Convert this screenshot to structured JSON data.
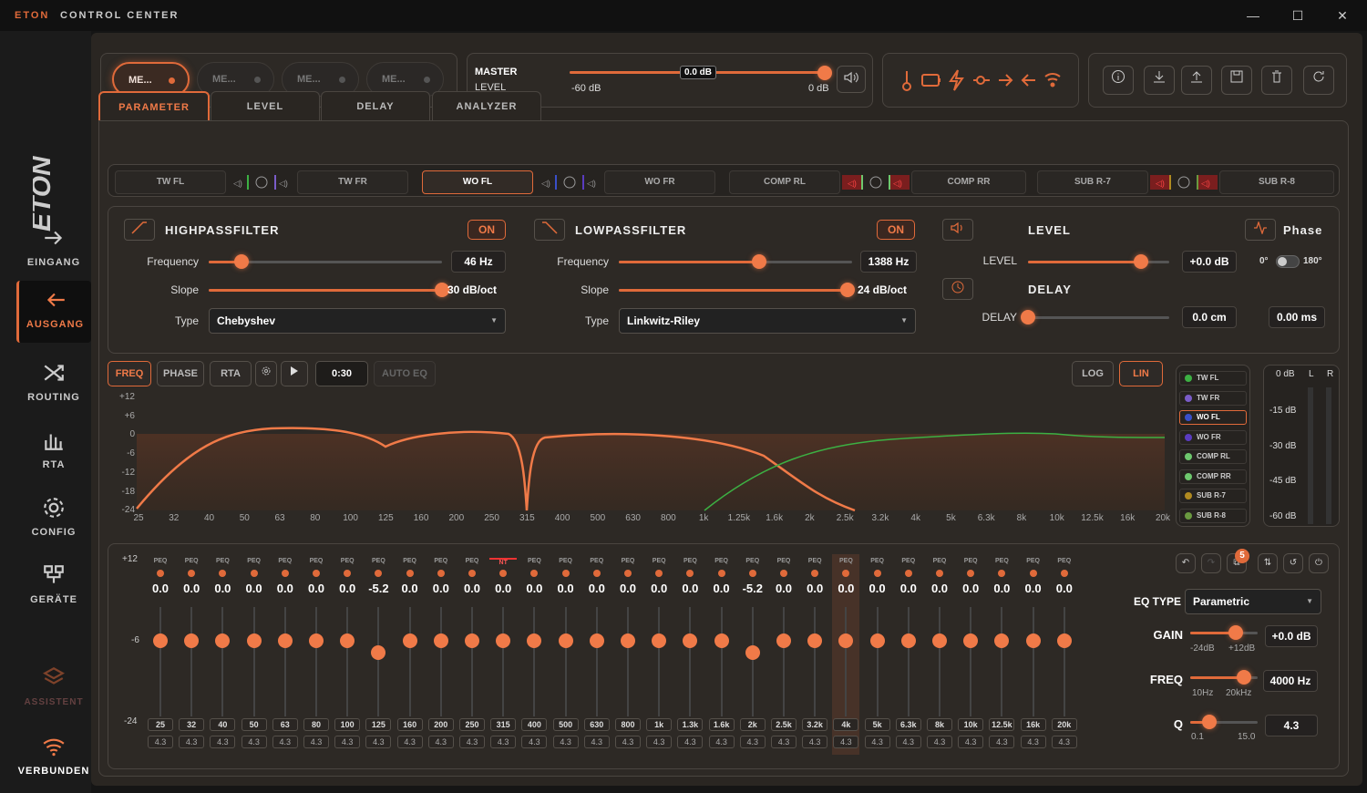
{
  "app": {
    "brand": "ETON",
    "title": "CONTROL CENTER"
  },
  "window": {
    "minimize": "—",
    "maximize": "☐",
    "close": "✕"
  },
  "sidebar": {
    "items": [
      {
        "label": "EINGANG",
        "icon": "arrow-right-icon",
        "active": false
      },
      {
        "label": "AUSGANG",
        "icon": "arrow-left-icon",
        "active": true
      },
      {
        "label": "ROUTING",
        "icon": "shuffle-icon",
        "active": false
      },
      {
        "label": "RTA",
        "icon": "bar-chart-icon",
        "active": false
      },
      {
        "label": "CONFIG",
        "icon": "gear-icon",
        "active": false
      },
      {
        "label": "GERÄTE",
        "icon": "devices-icon",
        "active": false
      },
      {
        "label": "ASSISTENT",
        "icon": "layers-icon",
        "active": false
      },
      {
        "label": "VERBUNDEN",
        "icon": "wifi-icon",
        "active": false
      }
    ]
  },
  "memory": {
    "slots": [
      {
        "label": "ME...",
        "active": true
      },
      {
        "label": "ME...",
        "active": false
      },
      {
        "label": "ME...",
        "active": false
      },
      {
        "label": "ME...",
        "active": false
      }
    ]
  },
  "master": {
    "label": "MASTER",
    "sub": "LEVEL",
    "value": "0.0 dB",
    "min": "-60 dB",
    "max": "0 dB",
    "level_fraction": 1.0
  },
  "status_icons": [
    "thermometer-icon",
    "battery-icon",
    "bolt-icon",
    "key-icon",
    "arrow-right-icon",
    "arrow-left-icon",
    "wifi-icon"
  ],
  "toolbar_icons": [
    "info-icon",
    "download-icon",
    "upload-icon",
    "save-icon",
    "delete-icon",
    "refresh-icon"
  ],
  "tabs": [
    {
      "label": "PARAMETER",
      "active": true
    },
    {
      "label": "LEVEL"
    },
    {
      "label": "DELAY"
    },
    {
      "label": "ANALYZER"
    }
  ],
  "channels": [
    {
      "label": "TW FL"
    },
    {
      "label": "TW FR"
    },
    {
      "label": "WO FL",
      "active": true
    },
    {
      "label": "WO FR"
    },
    {
      "label": "COMP RL"
    },
    {
      "label": "COMP RR"
    },
    {
      "label": "SUB R-7"
    },
    {
      "label": "SUB R-8"
    }
  ],
  "highpass": {
    "title": "HIGHPASSFILTER",
    "on": "ON",
    "freq_label": "Frequency",
    "freq": "46 Hz",
    "freq_fraction": 0.14,
    "slope_label": "Slope",
    "slope": "30 dB/oct",
    "slope_fraction": 1.0,
    "type_label": "Type",
    "type": "Chebyshev"
  },
  "lowpass": {
    "title": "LOWPASSFILTER",
    "on": "ON",
    "freq_label": "Frequency",
    "freq": "1388 Hz",
    "freq_fraction": 0.6,
    "slope_label": "Slope",
    "slope": "24 dB/oct",
    "slope_fraction": 0.98,
    "type_label": "Type",
    "type": "Linkwitz-Riley"
  },
  "level": {
    "title": "LEVEL",
    "label": "LEVEL",
    "value": "+0.0 dB",
    "fraction": 0.8
  },
  "phase": {
    "title": "Phase",
    "left": "0°",
    "right": "180°"
  },
  "delay": {
    "title": "DELAY",
    "label": "DELAY",
    "cm": "0.0 cm",
    "ms": "0.00 ms",
    "fraction": 0.0
  },
  "graph": {
    "buttons": {
      "freq": "FREQ",
      "phase": "PHASE",
      "rta": "RTA",
      "timer": "0:30",
      "autoeq": "AUTO EQ",
      "log": "LOG",
      "lin": "LIN"
    },
    "y_ticks": [
      "+12",
      "+6",
      "0",
      "-6",
      "-12",
      "-18",
      "-24"
    ],
    "x_ticks": [
      "25",
      "32",
      "40",
      "50",
      "63",
      "80",
      "100",
      "125",
      "160",
      "200",
      "250",
      "315",
      "400",
      "500",
      "630",
      "800",
      "1k",
      "1.25k",
      "1.6k",
      "2k",
      "2.5k",
      "3.2k",
      "4k",
      "5k",
      "6.3k",
      "8k",
      "10k",
      "12.5k",
      "16k",
      "20k"
    ],
    "legend": [
      {
        "label": "TW FL",
        "color": "#3cb043",
        "active": false
      },
      {
        "label": "TW FR",
        "color": "#7a5cc8",
        "active": false
      },
      {
        "label": "WO FL",
        "color": "#3a4fc8",
        "active": true
      },
      {
        "label": "WO FR",
        "color": "#5a3cc0",
        "active": false
      },
      {
        "label": "COMP RL",
        "color": "#6ec86e",
        "active": false
      },
      {
        "label": "COMP RR",
        "color": "#6ec86e",
        "active": false
      },
      {
        "label": "SUB R-7",
        "color": "#b08a20",
        "active": false
      },
      {
        "label": "SUB R-8",
        "color": "#6a9a40",
        "active": false
      }
    ]
  },
  "meter": {
    "top": "0 dB",
    "l": "L",
    "r": "R",
    "ticks": [
      "-15 dB",
      "-30 dB",
      "-45 dB",
      "-60 dB"
    ]
  },
  "eq": {
    "scale": [
      "+12",
      "-6",
      "-24"
    ],
    "bands": [
      {
        "t": "PEQ",
        "g": "0.0",
        "f": "25",
        "q": "4.3"
      },
      {
        "t": "PEQ",
        "g": "0.0",
        "f": "32",
        "q": "4.3"
      },
      {
        "t": "PEQ",
        "g": "0.0",
        "f": "40",
        "q": "4.3"
      },
      {
        "t": "PEQ",
        "g": "0.0",
        "f": "50",
        "q": "4.3"
      },
      {
        "t": "PEQ",
        "g": "0.0",
        "f": "63",
        "q": "4.3"
      },
      {
        "t": "PEQ",
        "g": "0.0",
        "f": "80",
        "q": "4.3"
      },
      {
        "t": "PEQ",
        "g": "0.0",
        "f": "100",
        "q": "4.3"
      },
      {
        "t": "PEQ",
        "g": "-5.2",
        "f": "125",
        "q": "4.3"
      },
      {
        "t": "PEQ",
        "g": "0.0",
        "f": "160",
        "q": "4.3"
      },
      {
        "t": "PEQ",
        "g": "0.0",
        "f": "200",
        "q": "4.3"
      },
      {
        "t": "PEQ",
        "g": "0.0",
        "f": "250",
        "q": "4.3"
      },
      {
        "t": "NT",
        "g": "0.0",
        "f": "315",
        "q": "4.3"
      },
      {
        "t": "PEQ",
        "g": "0.0",
        "f": "400",
        "q": "4.3"
      },
      {
        "t": "PEQ",
        "g": "0.0",
        "f": "500",
        "q": "4.3"
      },
      {
        "t": "PEQ",
        "g": "0.0",
        "f": "630",
        "q": "4.3"
      },
      {
        "t": "PEQ",
        "g": "0.0",
        "f": "800",
        "q": "4.3"
      },
      {
        "t": "PEQ",
        "g": "0.0",
        "f": "1k",
        "q": "4.3"
      },
      {
        "t": "PEQ",
        "g": "0.0",
        "f": "1.3k",
        "q": "4.3"
      },
      {
        "t": "PEQ",
        "g": "0.0",
        "f": "1.6k",
        "q": "4.3"
      },
      {
        "t": "PEQ",
        "g": "-5.2",
        "f": "2k",
        "q": "4.3"
      },
      {
        "t": "PEQ",
        "g": "0.0",
        "f": "2.5k",
        "q": "4.3"
      },
      {
        "t": "PEQ",
        "g": "0.0",
        "f": "3.2k",
        "q": "4.3"
      },
      {
        "t": "PEQ",
        "g": "0.0",
        "f": "4k",
        "q": "4.3",
        "sel": true
      },
      {
        "t": "PEQ",
        "g": "0.0",
        "f": "5k",
        "q": "4.3"
      },
      {
        "t": "PEQ",
        "g": "0.0",
        "f": "6.3k",
        "q": "4.3"
      },
      {
        "t": "PEQ",
        "g": "0.0",
        "f": "8k",
        "q": "4.3"
      },
      {
        "t": "PEQ",
        "g": "0.0",
        "f": "10k",
        "q": "4.3"
      },
      {
        "t": "PEQ",
        "g": "0.0",
        "f": "12.5k",
        "q": "4.3"
      },
      {
        "t": "PEQ",
        "g": "0.0",
        "f": "16k",
        "q": "4.3"
      },
      {
        "t": "PEQ",
        "g": "0.0",
        "f": "20k",
        "q": "4.3"
      }
    ],
    "badge": "5",
    "type_label": "EQ TYPE",
    "type": "Parametric",
    "gain_label": "GAIN",
    "gain": "+0.0 dB",
    "gain_min": "-24dB",
    "gain_max": "+12dB",
    "gain_fraction": 0.67,
    "freq_label": "FREQ",
    "freq": "4000 Hz",
    "freq_min": "10Hz",
    "freq_max": "20kHz",
    "freq_fraction": 0.8,
    "q_label": "Q",
    "q": "4.3",
    "q_min": "0.1",
    "q_max": "15.0",
    "q_fraction": 0.28
  }
}
